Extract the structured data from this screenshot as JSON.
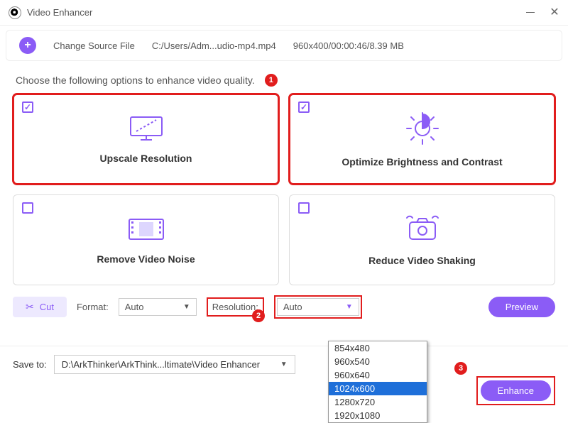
{
  "window": {
    "title": "Video Enhancer"
  },
  "source": {
    "change_label": "Change Source File",
    "path": "C:/Users/Adm...udio-mp4.mp4",
    "meta": "960x400/00:00:46/8.39 MB"
  },
  "intro": "Choose the following options to enhance video quality.",
  "steps": {
    "one": "1",
    "two": "2",
    "three": "3"
  },
  "cards": {
    "upscale": "Upscale Resolution",
    "brightness": "Optimize Brightness and Contrast",
    "noise": "Remove Video Noise",
    "shaking": "Reduce Video Shaking"
  },
  "controls": {
    "cut": "Cut",
    "format_label": "Format:",
    "format_value": "Auto",
    "resolution_label": "Resolution:",
    "resolution_value": "Auto",
    "preview": "Preview"
  },
  "resolution_options": [
    "854x480",
    "960x540",
    "960x640",
    "1024x600",
    "1280x720",
    "1920x1080"
  ],
  "resolution_selected": "1024x600",
  "save": {
    "label": "Save to:",
    "path": "D:\\ArkThinker\\ArkThink...ltimate\\Video Enhancer",
    "enhance": "Enhance"
  }
}
